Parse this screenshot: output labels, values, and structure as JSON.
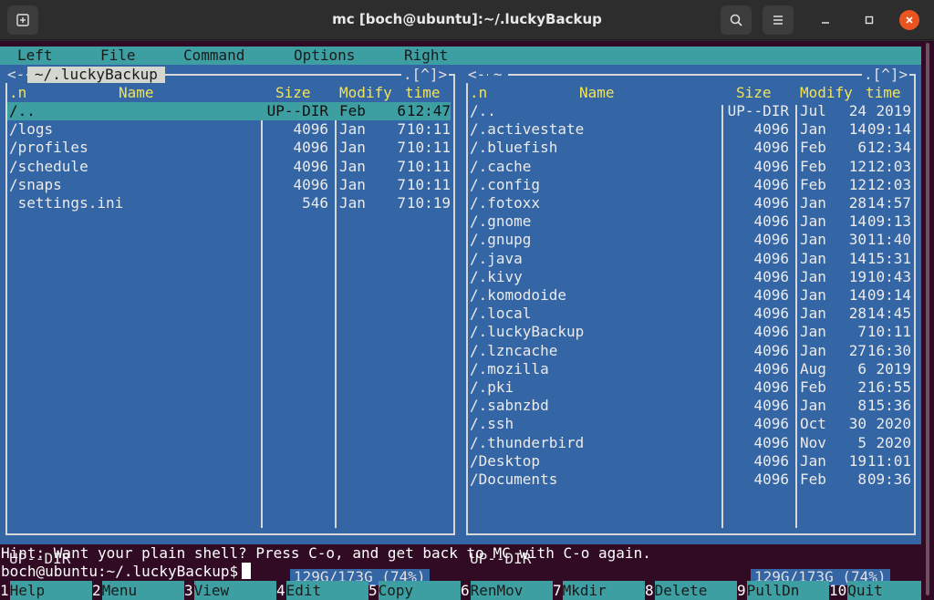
{
  "window": {
    "title": "mc [boch@ubuntu]:~/.luckyBackup",
    "icons": [
      "new-tab-icon",
      "search-icon",
      "hamburger-icon",
      "minimize-icon",
      "maximize-icon",
      "close-icon"
    ],
    "close_color": "#e95420"
  },
  "menubar": {
    "items": [
      "Left",
      "File",
      "Command",
      "Options",
      "Right"
    ]
  },
  "left_panel": {
    "path": "~/.luckyBackup",
    "nav_left": "<-",
    "nav_right": ".[^]>",
    "columns": {
      "sort": ".n",
      "name": "Name",
      "size": "Size",
      "modify": "Modify",
      "time": "time"
    },
    "rows": [
      {
        "name": "/..",
        "size": "UP--DIR",
        "month": "Feb",
        "day": "6",
        "time": "12:47",
        "selected": true
      },
      {
        "name": "/logs",
        "size": "4096",
        "month": "Jan",
        "day": "7",
        "time": "10:11"
      },
      {
        "name": "/profiles",
        "size": "4096",
        "month": "Jan",
        "day": "7",
        "time": "10:11"
      },
      {
        "name": "/schedule",
        "size": "4096",
        "month": "Jan",
        "day": "7",
        "time": "10:11"
      },
      {
        "name": "/snaps",
        "size": "4096",
        "month": "Jan",
        "day": "7",
        "time": "10:11"
      },
      {
        "name": " settings.ini",
        "size": "546",
        "month": "Jan",
        "day": "7",
        "time": "10:19"
      }
    ],
    "mini_status": "UP--DIR",
    "disk": "129G/173G (74%)"
  },
  "right_panel": {
    "path": "~",
    "nav_left": "<-",
    "nav_right": ".[^]>",
    "columns": {
      "sort": ".n",
      "name": "Name",
      "size": "Size",
      "modify": "Modify",
      "time": "time"
    },
    "rows": [
      {
        "name": "/..",
        "size": "UP--DIR",
        "month": "Jul",
        "day": "24",
        "time": "2019"
      },
      {
        "name": "/.activestate",
        "size": "4096",
        "month": "Jan",
        "day": "14",
        "time": "09:14"
      },
      {
        "name": "/.bluefish",
        "size": "4096",
        "month": "Feb",
        "day": "6",
        "time": "12:34"
      },
      {
        "name": "/.cache",
        "size": "4096",
        "month": "Feb",
        "day": "12",
        "time": "12:03"
      },
      {
        "name": "/.config",
        "size": "4096",
        "month": "Feb",
        "day": "12",
        "time": "12:03"
      },
      {
        "name": "/.fotoxx",
        "size": "4096",
        "month": "Jan",
        "day": "28",
        "time": "14:57"
      },
      {
        "name": "/.gnome",
        "size": "4096",
        "month": "Jan",
        "day": "14",
        "time": "09:13"
      },
      {
        "name": "/.gnupg",
        "size": "4096",
        "month": "Jan",
        "day": "30",
        "time": "11:40"
      },
      {
        "name": "/.java",
        "size": "4096",
        "month": "Jan",
        "day": "14",
        "time": "15:31"
      },
      {
        "name": "/.kivy",
        "size": "4096",
        "month": "Jan",
        "day": "19",
        "time": "10:43"
      },
      {
        "name": "/.komodoide",
        "size": "4096",
        "month": "Jan",
        "day": "14",
        "time": "09:14"
      },
      {
        "name": "/.local",
        "size": "4096",
        "month": "Jan",
        "day": "28",
        "time": "14:45"
      },
      {
        "name": "/.luckyBackup",
        "size": "4096",
        "month": "Jan",
        "day": "7",
        "time": "10:11"
      },
      {
        "name": "/.lzncache",
        "size": "4096",
        "month": "Jan",
        "day": "27",
        "time": "16:30"
      },
      {
        "name": "/.mozilla",
        "size": "4096",
        "month": "Aug",
        "day": "6",
        "time": "2019"
      },
      {
        "name": "/.pki",
        "size": "4096",
        "month": "Feb",
        "day": "2",
        "time": "16:55"
      },
      {
        "name": "/.sabnzbd",
        "size": "4096",
        "month": "Jan",
        "day": "8",
        "time": "15:36"
      },
      {
        "name": "/.ssh",
        "size": "4096",
        "month": "Oct",
        "day": "30",
        "time": "2020"
      },
      {
        "name": "/.thunderbird",
        "size": "4096",
        "month": "Nov",
        "day": "5",
        "time": "2020"
      },
      {
        "name": "/Desktop",
        "size": "4096",
        "month": "Jan",
        "day": "19",
        "time": "11:01"
      },
      {
        "name": "/Documents",
        "size": "4096",
        "month": "Feb",
        "day": "8",
        "time": "09:36"
      }
    ],
    "mini_status": "UP--DIR",
    "disk": "129G/173G (74%)"
  },
  "hint": "Hint: Want your plain shell? Press C-o, and get back to MC with C-o again.",
  "prompt": "boch@ubuntu:~/.luckyBackup$",
  "fkeys": [
    {
      "num": "1",
      "label": "Help"
    },
    {
      "num": "2",
      "label": "Menu"
    },
    {
      "num": "3",
      "label": "View"
    },
    {
      "num": "4",
      "label": "Edit"
    },
    {
      "num": "5",
      "label": "Copy"
    },
    {
      "num": "6",
      "label": "RenMov"
    },
    {
      "num": "7",
      "label": "Mkdir"
    },
    {
      "num": "8",
      "label": "Delete"
    },
    {
      "num": "9",
      "label": "PullDn"
    },
    {
      "num": "10",
      "label": "Quit"
    }
  ]
}
